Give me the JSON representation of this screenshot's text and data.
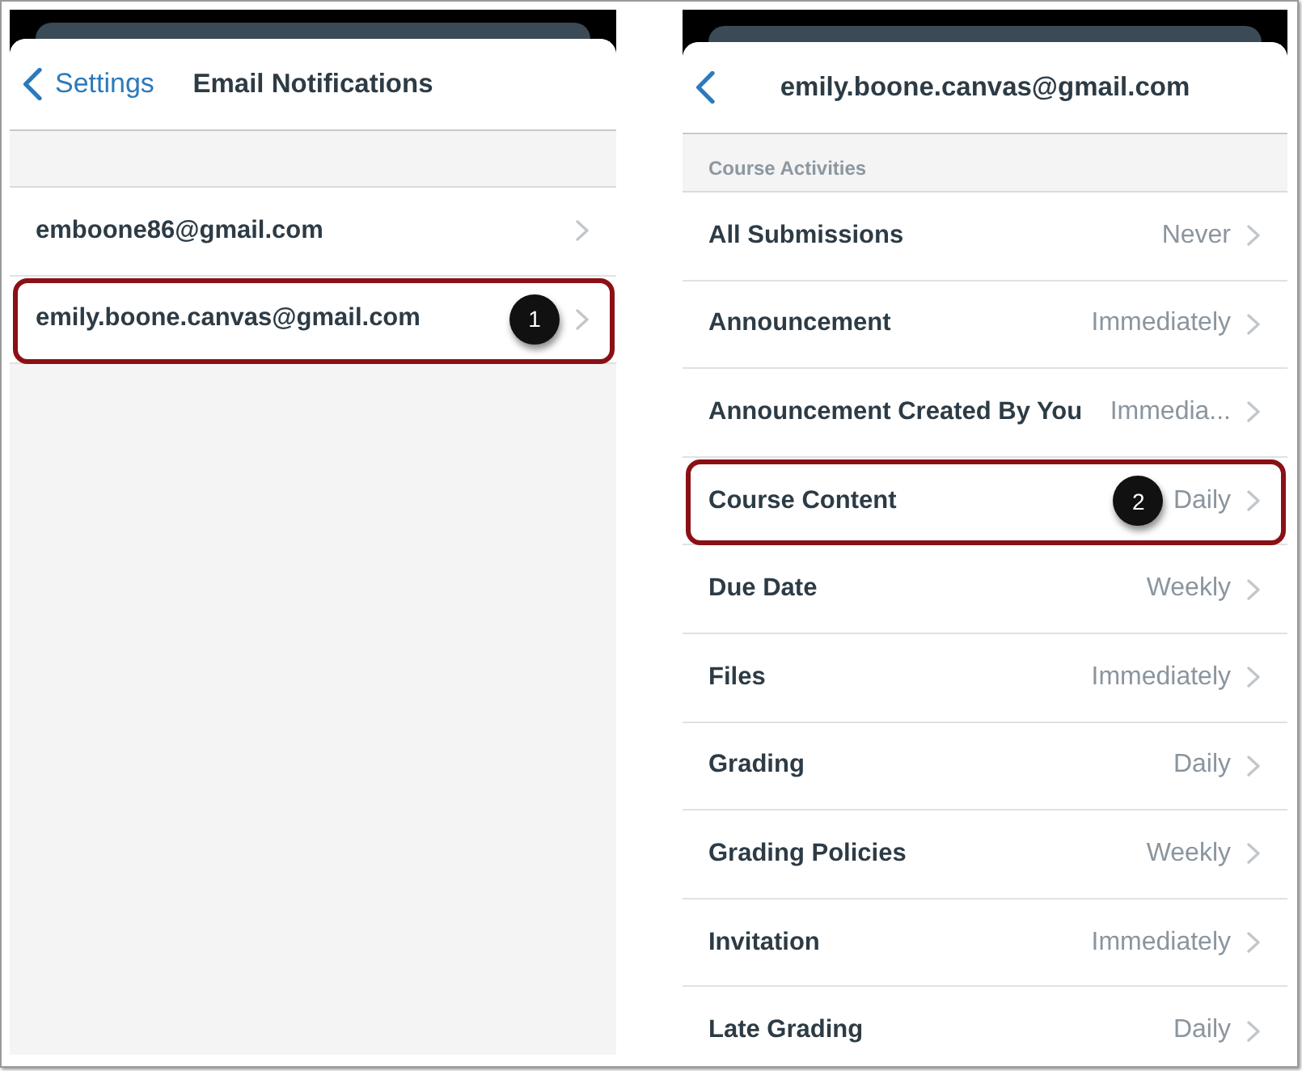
{
  "screens": [
    {
      "back_label": "Settings",
      "title": "Email Notifications",
      "rows": [
        {
          "label": "emboone86@gmail.com",
          "highlighted": false
        },
        {
          "label": "emily.boone.canvas@gmail.com",
          "highlighted": true,
          "callout": "1"
        }
      ]
    },
    {
      "title": "emily.boone.canvas@gmail.com",
      "section_header": "Course Activities",
      "rows": [
        {
          "label": "All Submissions",
          "value": "Never",
          "highlighted": false
        },
        {
          "label": "Announcement",
          "value": "Immediately",
          "highlighted": false
        },
        {
          "label": "Announcement Created By You",
          "value": "Immedia...",
          "highlighted": false
        },
        {
          "label": "Course Content",
          "value": "Daily",
          "highlighted": true,
          "callout": "2"
        },
        {
          "label": "Due Date",
          "value": "Weekly",
          "highlighted": false
        },
        {
          "label": "Files",
          "value": "Immediately",
          "highlighted": false
        },
        {
          "label": "Grading",
          "value": "Daily",
          "highlighted": false
        },
        {
          "label": "Grading Policies",
          "value": "Weekly",
          "highlighted": false
        },
        {
          "label": "Invitation",
          "value": "Immediately",
          "highlighted": false
        },
        {
          "label": "Late Grading",
          "value": "Daily",
          "highlighted": false
        }
      ]
    }
  ]
}
